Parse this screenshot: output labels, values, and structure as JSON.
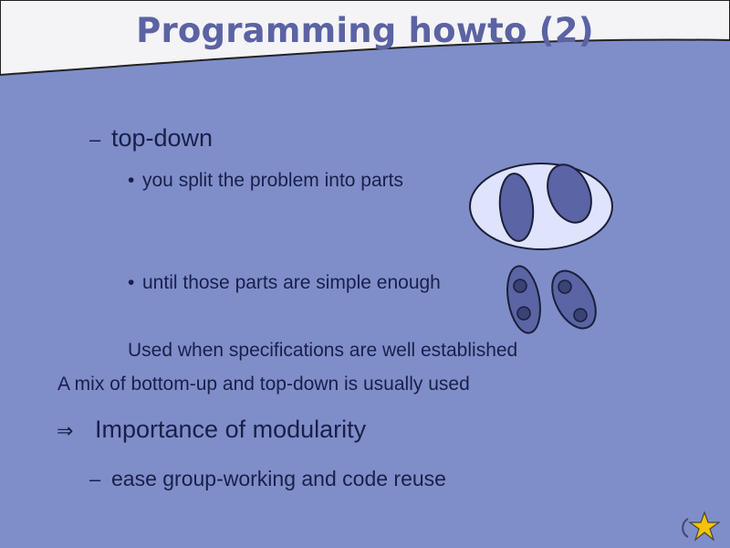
{
  "slide": {
    "title": "Programming howto (2)",
    "items": {
      "topdown_marker": "–",
      "topdown": "top-down",
      "bullet": "•",
      "split": "you split the problem into parts",
      "simple": "until those parts are simple enough",
      "used_when": "Used when specifications are well established",
      "mix": "A mix of bottom-up and top-down is usually used",
      "arrow": "⇒",
      "importance": "Importance of modularity",
      "ease_marker": "–",
      "ease": "ease group-working and code reuse"
    },
    "icons": {
      "split_problem": "ellipse-with-two-parts-illustration",
      "simple_parts": "two-parts-with-dots-illustration",
      "corner": "star-icon"
    },
    "colors": {
      "background": "#7f8ec9",
      "header": "#f4f4f6",
      "title": "#5b63a3",
      "text": "#1a1f4a",
      "shape_fill": "#5b64a4",
      "ellipse_fill": "#dfe3fb",
      "star": "#f5c400"
    }
  }
}
